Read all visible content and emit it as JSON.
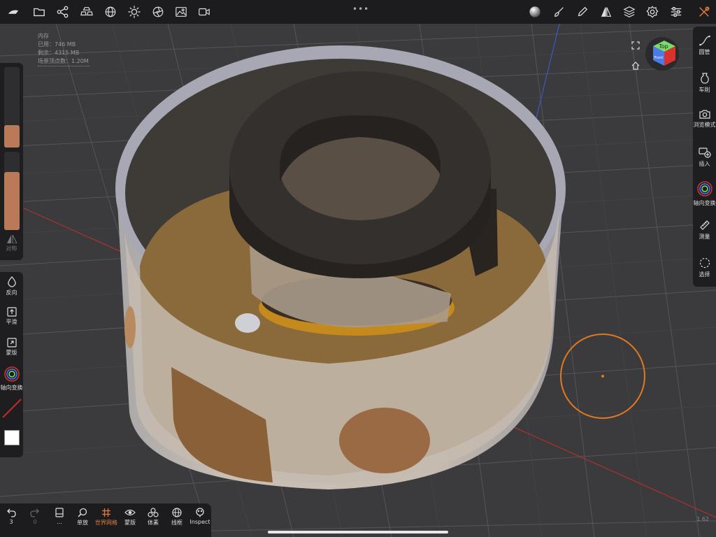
{
  "toolbar": {
    "left_icons": [
      "app-logo-icon",
      "folder-icon",
      "share-nodes-icon",
      "boxes-icon",
      "globe-icon",
      "sun-icon",
      "aperture-icon",
      "image-icon",
      "video-camera-icon"
    ],
    "right_icons": [
      "material-sphere-icon",
      "brush-icon",
      "eyedropper-icon",
      "mirror-icon",
      "layers-icon",
      "settings-icon",
      "sliders-icon",
      "tools-icon"
    ],
    "more_dots": "•••"
  },
  "memory": {
    "label": "内存",
    "used": "已用：746 MB",
    "free": "剩余：4315 MB",
    "vertices": "场景顶点数：1.20M"
  },
  "left_panel": {
    "slider_size_fill": 0.28,
    "slider_strength_fill": 0.74,
    "symmetry_label": "对称",
    "items": [
      {
        "icon": "drop-icon",
        "label": "反向"
      },
      {
        "icon": "smooth-icon",
        "label": "平滑"
      },
      {
        "icon": "mask-icon",
        "label": "蒙版"
      },
      {
        "icon": "gizmo-icon",
        "label": "轴向变换"
      }
    ]
  },
  "right_panel": {
    "items": [
      {
        "icon": "tube-icon",
        "label": "圆管"
      },
      {
        "icon": "vase-icon",
        "label": "车削"
      },
      {
        "icon": "camera-icon",
        "label": "浏览模式"
      },
      {
        "icon": "insert-icon",
        "label": "插入"
      },
      {
        "icon": "gizmo-icon",
        "label": "轴向变换"
      },
      {
        "icon": "ruler-icon",
        "label": "测量"
      },
      {
        "icon": "select-icon",
        "label": "选择"
      }
    ]
  },
  "view_cube": {
    "top": "Top",
    "front": "Front",
    "top_color": "#7bdc6c",
    "front_color": "#4a7be8",
    "right_color": "#d8322e"
  },
  "bottom_bar": {
    "undo_count": "3",
    "redo_count": "0",
    "more_label": "...",
    "items": [
      {
        "icon": "magnifier-icon",
        "label": "单放",
        "active": false
      },
      {
        "icon": "grid-hash-icon",
        "label": "世界网格",
        "active": true
      },
      {
        "icon": "eye-icon",
        "label": "蒙版",
        "active": false
      },
      {
        "icon": "voxel-icon",
        "label": "体素",
        "active": false
      },
      {
        "icon": "wireframe-icon",
        "label": "线框",
        "active": false
      },
      {
        "icon": "inspect-icon",
        "label": "Inspect",
        "active": false
      }
    ]
  },
  "corner_number": "1.62",
  "colors": {
    "accent": "#e07a3f",
    "panel": "#1e1e20",
    "brown": "#b87a58"
  }
}
